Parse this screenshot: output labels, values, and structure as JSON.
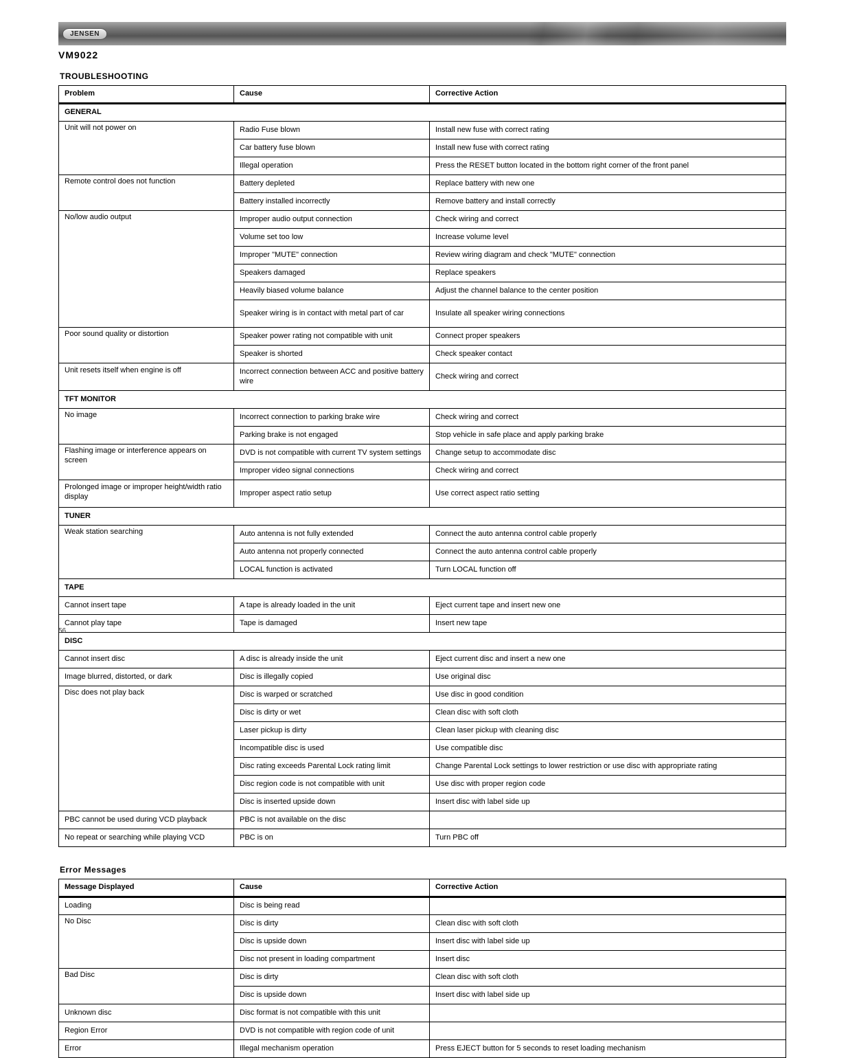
{
  "brand": "JENSEN",
  "product": "VM9022",
  "section1_title": "TROUBLESHOOTING",
  "section2_title": "Error Messages",
  "page_number": "56",
  "table1": {
    "headers": [
      "Problem",
      "Cause",
      "Corrective Action"
    ],
    "subheads": [
      "GENERAL",
      "TFT MONITOR",
      "TUNER",
      "TAPE",
      "DISC"
    ],
    "general": [
      [
        "Unit will not power on",
        "Radio Fuse blown",
        "Install new fuse with correct rating"
      ],
      [
        "",
        "Car battery fuse blown",
        "Install new fuse with correct rating"
      ],
      [
        "",
        "Illegal operation",
        "Press the RESET button located in the bottom right corner of the front panel"
      ],
      [
        "Remote control does not function",
        "Battery depleted",
        "Replace battery with new one"
      ],
      [
        "",
        "Battery installed incorrectly",
        "Remove battery and install correctly"
      ],
      [
        "No/low audio output",
        "Improper audio output connection",
        "Check wiring and correct"
      ],
      [
        "",
        "Volume set too low",
        "Increase volume level"
      ],
      [
        "",
        "Improper \"MUTE\" connection",
        "Review wiring diagram and check \"MUTE\" connection"
      ],
      [
        "",
        "Speakers damaged",
        "Replace speakers"
      ],
      [
        "",
        "Heavily biased volume balance",
        "Adjust the channel balance to the center position"
      ],
      [
        "",
        "Speaker wiring is in contact with metal part of car",
        "Insulate all speaker wiring connections"
      ],
      [
        "Poor sound quality or distortion",
        "Speaker power rating not compatible with unit",
        "Connect proper speakers"
      ],
      [
        "",
        "Speaker is shorted",
        "Check speaker contact"
      ],
      [
        "Unit resets itself when engine is off",
        "Incorrect connection between ACC and positive battery wire",
        "Check wiring and correct"
      ]
    ],
    "tft": [
      [
        "No image",
        "Incorrect connection to parking brake wire",
        "Check wiring and correct"
      ],
      [
        "",
        "Parking brake is not engaged",
        "Stop vehicle in safe place and apply parking brake"
      ],
      [
        "Flashing image or interference appears on screen",
        "DVD is not compatible with current TV system settings",
        "Change setup to accommodate disc"
      ],
      [
        "",
        "Improper video signal connections",
        "Check wiring and correct"
      ],
      [
        "Prolonged image or improper height/width ratio display",
        "Improper aspect ratio setup",
        "Use correct aspect ratio setting"
      ]
    ],
    "tuner": [
      [
        "Weak station searching",
        "Auto antenna is not fully extended",
        "Connect the auto antenna control cable properly"
      ],
      [
        "",
        "Auto antenna not properly connected",
        "Connect the auto antenna control cable properly"
      ],
      [
        "",
        "LOCAL function is activated",
        "Turn LOCAL function off"
      ]
    ],
    "tape": [
      [
        "Cannot insert tape",
        "A tape is already loaded in the unit",
        "Eject current tape and insert new one"
      ],
      [
        "Cannot play tape",
        "Tape is damaged",
        "Insert new tape"
      ]
    ],
    "disc": [
      [
        "Cannot insert disc",
        "A disc is already inside the unit",
        "Eject current disc and insert a new one"
      ],
      [
        "Image blurred, distorted, or dark",
        "Disc is illegally copied",
        "Use original disc"
      ],
      [
        "Disc does not play back",
        "Disc is warped or scratched",
        "Use disc in good condition"
      ],
      [
        "",
        "Disc is dirty or wet",
        "Clean disc with soft cloth"
      ],
      [
        "",
        "Laser pickup is dirty",
        "Clean laser pickup with cleaning disc"
      ],
      [
        "",
        "Incompatible disc is used",
        "Use compatible disc"
      ],
      [
        "",
        "Disc rating exceeds Parental Lock rating limit",
        "Change Parental Lock settings to lower restriction or use disc with appropriate rating"
      ],
      [
        "",
        "Disc region code is not compatible with unit",
        "Use disc with proper region code"
      ],
      [
        "",
        "Disc is inserted upside down",
        "Insert disc with label side up"
      ],
      [
        "PBC cannot be used during VCD playback",
        "PBC is not available on the disc",
        ""
      ],
      [
        "No repeat or searching while playing VCD",
        "PBC is on",
        "Turn PBC off"
      ]
    ]
  },
  "table2": {
    "headers": [
      "Message Displayed",
      "Cause",
      "Corrective Action"
    ],
    "rows": [
      [
        "Loading",
        "Disc is being read",
        ""
      ],
      [
        "No Disc",
        "Disc is dirty",
        "Clean disc with soft cloth"
      ],
      [
        "",
        "Disc is upside down",
        "Insert disc with label side up"
      ],
      [
        "",
        "Disc not present in loading compartment",
        "Insert disc"
      ],
      [
        "Bad Disc",
        "Disc is dirty",
        "Clean disc with soft cloth"
      ],
      [
        "",
        "Disc is upside down",
        "Insert disc with label side up"
      ],
      [
        "Unknown disc",
        "Disc format is not compatible with this unit",
        ""
      ],
      [
        "Region Error",
        "DVD is not compatible with region code of unit",
        ""
      ],
      [
        "Error",
        "Illegal mechanism operation",
        "Press EJECT button for 5 seconds to reset loading mechanism"
      ]
    ]
  }
}
